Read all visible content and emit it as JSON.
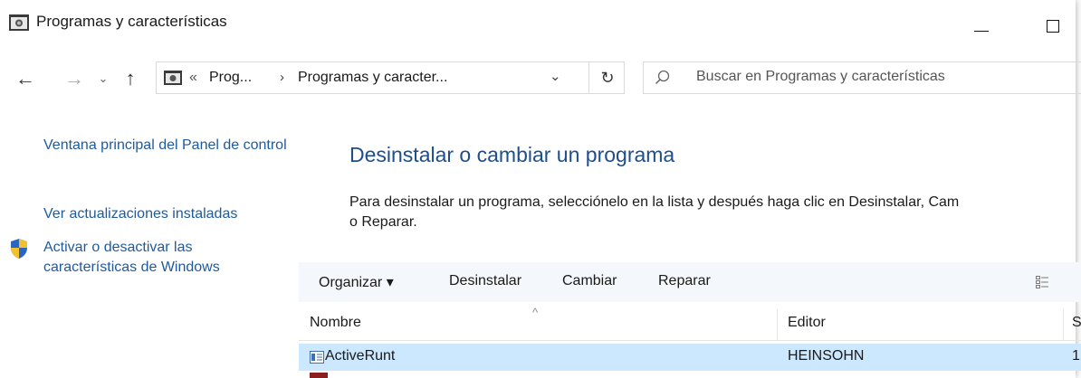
{
  "window": {
    "title": "Programas y características"
  },
  "nav": {
    "breadcrumb_prefix": "«",
    "crumb1": "Prog...",
    "crumb2": "Programas y caracter...",
    "separator": "›",
    "search_placeholder": "Buscar en Programas y características"
  },
  "sidebar": {
    "link_home": "Ventana principal del Panel de control",
    "link_updates": "Ver actualizaciones instaladas",
    "link_features": "Activar o desactivar las características de Windows"
  },
  "main": {
    "heading": "Desinstalar o cambiar un programa",
    "description_line1": "Para desinstalar un programa, selecciónelo en la lista y después haga clic en Desinstalar, Cam",
    "description_line2": "o Reparar."
  },
  "toolbar": {
    "organize": "Organizar ▾",
    "uninstall": "Desinstalar",
    "change": "Cambiar",
    "repair": "Reparar"
  },
  "table": {
    "columns": [
      "Nombre",
      "Editor",
      "S"
    ],
    "rows": [
      {
        "name": "ActiveRunt",
        "publisher": "HEINSOHN",
        "extra": "1"
      }
    ]
  },
  "colors": {
    "link": "#1e5a9c",
    "heading": "#1e4e8c",
    "selected_row": "#cce8ff",
    "toolbar_bg": "#f4f7fb"
  }
}
